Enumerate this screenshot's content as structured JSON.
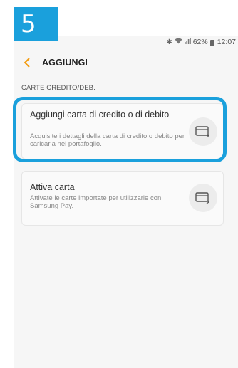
{
  "step_number": "5",
  "status_bar": {
    "battery": "62%",
    "time": "12:07"
  },
  "header": {
    "title": "AGGIUNGI"
  },
  "section_label": "CARTE CREDITO/DEB.",
  "cards": [
    {
      "title": "Aggiungi carta di credito o di debito",
      "description": "Acquisite i dettagli della carta di credito o debito per caricarla nel portafoglio.",
      "icon": "add-card-icon"
    },
    {
      "title": "Attiva carta",
      "description": "Attivate le carte importate per utilizzarle con Samsung Pay.",
      "icon": "activate-card-icon"
    }
  ],
  "colors": {
    "accent": "#1aa0dc",
    "back_arrow": "#f39c12"
  }
}
